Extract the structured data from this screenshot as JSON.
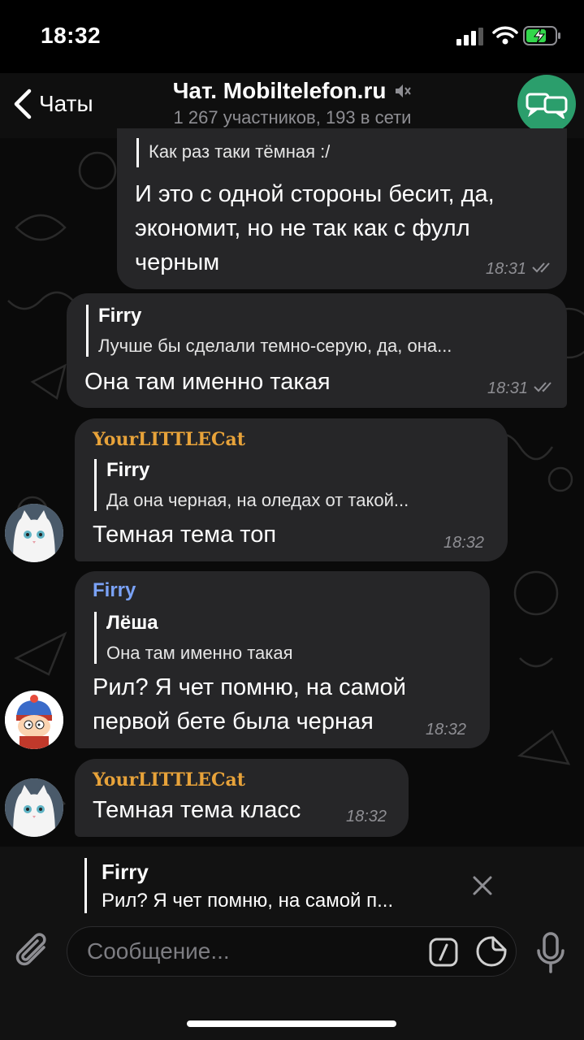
{
  "status": {
    "time": "18:32"
  },
  "header": {
    "back_label": "Чаты",
    "title": "Чат. Mobiltelefon.ru",
    "subtitle": "1 267 участников, 193 в сети"
  },
  "messages": [
    {
      "quote_text": "Как раз таки тёмная :/",
      "text_lines": [
        "И это с одной стороны бесит, да,",
        "экономит, но не так как с фулл",
        "черным"
      ],
      "time": "18:31"
    },
    {
      "quote_name": "Firry",
      "quote_text": "Лучше бы сделали темно-серую, да, она...",
      "text": "Она там именно такая",
      "time": "18:31"
    },
    {
      "sender": "YourLITTLECat",
      "quote_name": "Firry",
      "quote_text": "Да она черная, на оледах от такой...",
      "text": "Темная тема топ",
      "time": "18:32"
    },
    {
      "sender": "Firry",
      "quote_name": "Лёша",
      "quote_text": "Она там именно такая",
      "text_lines": [
        "Рил? Я чет помню, на самой",
        "первой бете была черная"
      ],
      "time": "18:32"
    },
    {
      "sender": "YourLITTLECat",
      "text": "Темная тема класс",
      "time": "18:32"
    }
  ],
  "compose": {
    "reply_name": "Firry",
    "reply_text": "Рил? Я чет помню, на самой п...",
    "placeholder": "Сообщение..."
  },
  "colors": {
    "firry": "#7aa2f7",
    "cat_name": "#e8a33a",
    "accent_green": "#2b9e6c"
  }
}
